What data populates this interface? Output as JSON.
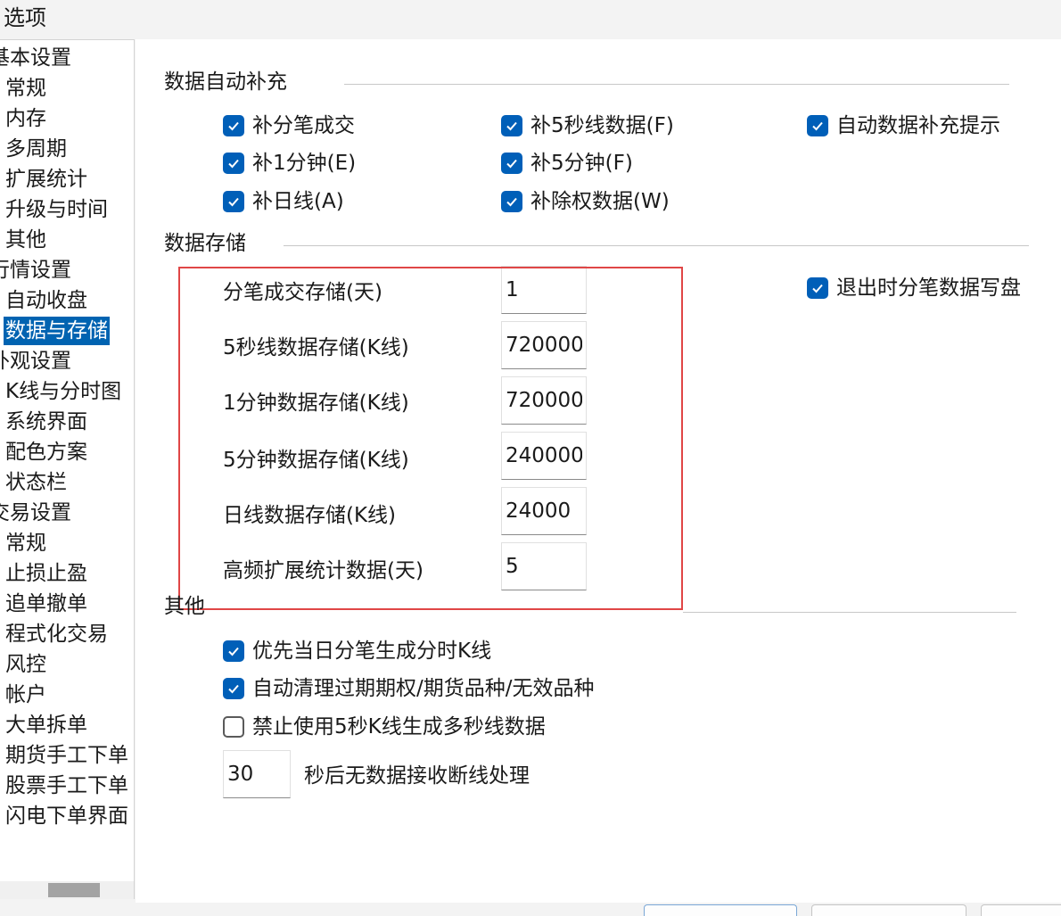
{
  "window": {
    "title": "选项"
  },
  "sidebar": {
    "items": [
      {
        "label": "基本设置",
        "level": 0,
        "selected": false
      },
      {
        "label": "常规",
        "level": 1,
        "selected": false
      },
      {
        "label": "内存",
        "level": 1,
        "selected": false
      },
      {
        "label": "多周期",
        "level": 1,
        "selected": false
      },
      {
        "label": "扩展统计",
        "level": 1,
        "selected": false
      },
      {
        "label": "升级与时间",
        "level": 1,
        "selected": false
      },
      {
        "label": "其他",
        "level": 1,
        "selected": false
      },
      {
        "label": "行情设置",
        "level": 0,
        "selected": false
      },
      {
        "label": "自动收盘",
        "level": 1,
        "selected": false
      },
      {
        "label": "数据与存储",
        "level": 1,
        "selected": true
      },
      {
        "label": "外观设置",
        "level": 0,
        "selected": false
      },
      {
        "label": "K线与分时图",
        "level": 1,
        "selected": false
      },
      {
        "label": "系统界面",
        "level": 1,
        "selected": false
      },
      {
        "label": "配色方案",
        "level": 1,
        "selected": false
      },
      {
        "label": "状态栏",
        "level": 1,
        "selected": false
      },
      {
        "label": "交易设置",
        "level": 0,
        "selected": false
      },
      {
        "label": "常规",
        "level": 1,
        "selected": false
      },
      {
        "label": "止损止盈",
        "level": 1,
        "selected": false
      },
      {
        "label": "追单撤单",
        "level": 1,
        "selected": false
      },
      {
        "label": "程式化交易",
        "level": 1,
        "selected": false
      },
      {
        "label": "风控",
        "level": 1,
        "selected": false
      },
      {
        "label": "帐户",
        "level": 1,
        "selected": false
      },
      {
        "label": "大单拆单",
        "level": 1,
        "selected": false
      },
      {
        "label": "期货手工下单",
        "level": 1,
        "selected": false
      },
      {
        "label": "股票手工下单",
        "level": 1,
        "selected": false
      },
      {
        "label": "闪电下单界面",
        "level": 1,
        "selected": false
      }
    ]
  },
  "auto_fill": {
    "title": "数据自动补充",
    "options": [
      {
        "label": "补分笔成交",
        "checked": true
      },
      {
        "label": "补5秒线数据(F)",
        "checked": true
      },
      {
        "label": "自动数据补充提示",
        "checked": true
      },
      {
        "label": "补1分钟(E)",
        "checked": true
      },
      {
        "label": "补5分钟(F)",
        "checked": true
      },
      {
        "label": "补日线(A)",
        "checked": true
      },
      {
        "label": "补除权数据(W)",
        "checked": true
      }
    ]
  },
  "storage": {
    "title": "数据存储",
    "fields": [
      {
        "label": "分笔成交存储(天)",
        "value": "1"
      },
      {
        "label": "5秒线数据存储(K线)",
        "value": "720000"
      },
      {
        "label": "1分钟数据存储(K线)",
        "value": "720000"
      },
      {
        "label": "5分钟数据存储(K线)",
        "value": "240000"
      },
      {
        "label": "日线数据存储(K线)",
        "value": "24000"
      },
      {
        "label": "高频扩展统计数据(天)",
        "value": "5"
      }
    ],
    "write_on_exit": {
      "label": "退出时分笔数据写盘",
      "checked": true
    }
  },
  "other": {
    "title": "其他",
    "options": [
      {
        "label": "优先当日分笔生成分时K线",
        "checked": true
      },
      {
        "label": "自动清理过期期权/期货品种/无效品种",
        "checked": true
      },
      {
        "label": "禁止使用5秒K线生成多秒线数据",
        "checked": false
      }
    ],
    "timeout": {
      "value": "30",
      "label": "秒后无数据接收断线处理"
    }
  },
  "colors": {
    "accent": "#005fb8",
    "selection": "#0063b1",
    "highlight_border": "#e04646"
  }
}
